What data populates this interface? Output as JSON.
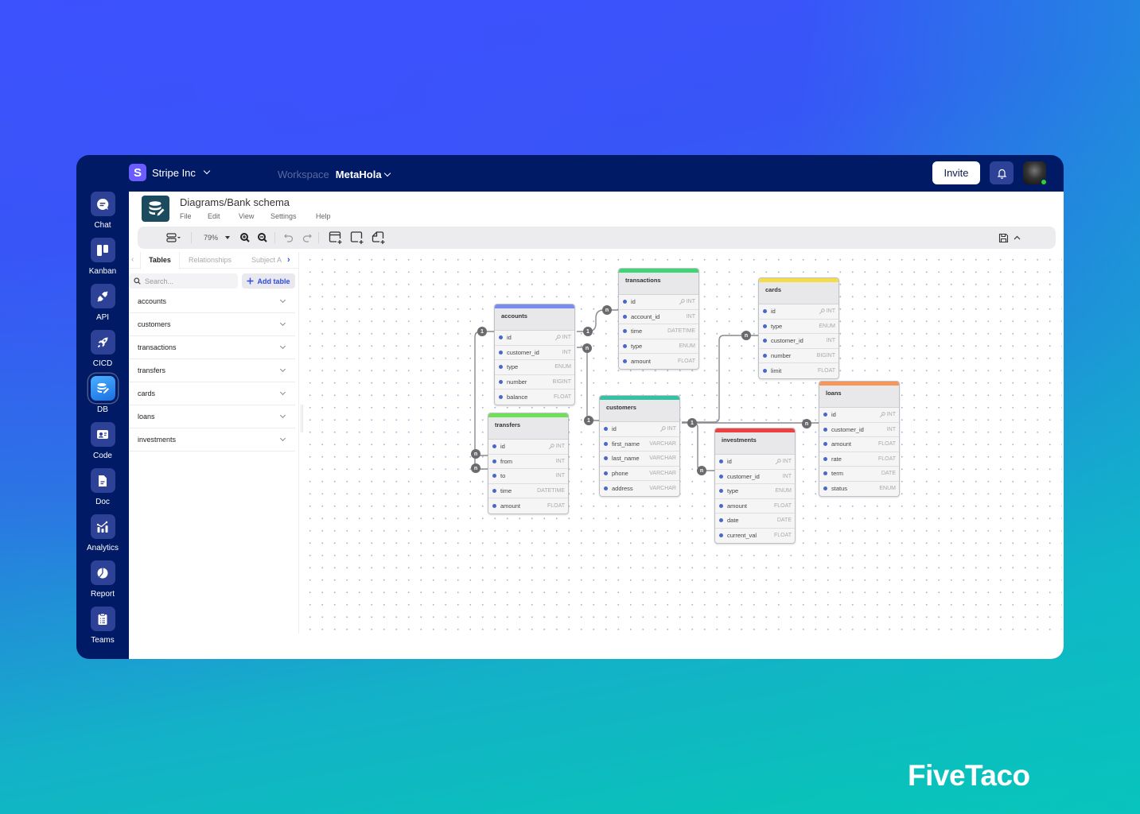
{
  "app": {
    "org_name": "Stripe Inc",
    "org_logo_letter": "S",
    "workspace_label": "Workspace",
    "workspace_name": "MetaHola",
    "invite_label": "Invite"
  },
  "nav": [
    {
      "label": "Chat",
      "icon": "chat-icon"
    },
    {
      "label": "Kanban",
      "icon": "kanban-icon"
    },
    {
      "label": "API",
      "icon": "api-plug-icon"
    },
    {
      "label": "CICD",
      "icon": "rocket-icon"
    },
    {
      "label": "DB",
      "icon": "database-icon",
      "active": true
    },
    {
      "label": "Code",
      "icon": "code-icon"
    },
    {
      "label": "Doc",
      "icon": "document-icon"
    },
    {
      "label": "Analytics",
      "icon": "analytics-icon"
    },
    {
      "label": "Report",
      "icon": "pie-chart-icon"
    },
    {
      "label": "Teams",
      "icon": "clipboard-icon"
    }
  ],
  "document": {
    "title": "Diagrams/Bank schema",
    "menu": [
      "File",
      "Edit",
      "View",
      "Settings",
      "Help"
    ]
  },
  "toolbar": {
    "zoom": "79%"
  },
  "panel": {
    "tabs": [
      "Tables",
      "Relationships",
      "Subject Areas"
    ],
    "active_tab": "Tables",
    "search_placeholder": "Search...",
    "add_table_label": "Add table",
    "tables": [
      "accounts",
      "customers",
      "transactions",
      "transfers",
      "cards",
      "loans",
      "investments"
    ]
  },
  "diagram": {
    "tables": [
      {
        "name": "accounts",
        "color": "#7b8cf0",
        "fields": [
          {
            "name": "id",
            "type": "INT",
            "pk": true
          },
          {
            "name": "customer_id",
            "type": "INT"
          },
          {
            "name": "type",
            "type": "ENUM"
          },
          {
            "name": "number",
            "type": "BIGINT"
          },
          {
            "name": "balance",
            "type": "FLOAT"
          }
        ]
      },
      {
        "name": "transactions",
        "color": "#3ed477",
        "fields": [
          {
            "name": "id",
            "type": "INT",
            "pk": true
          },
          {
            "name": "account_id",
            "type": "INT"
          },
          {
            "name": "time",
            "type": "DATETIME"
          },
          {
            "name": "type",
            "type": "ENUM"
          },
          {
            "name": "amount",
            "type": "FLOAT"
          }
        ]
      },
      {
        "name": "cards",
        "color": "#f5dc4a",
        "fields": [
          {
            "name": "id",
            "type": "INT",
            "pk": true
          },
          {
            "name": "type",
            "type": "ENUM"
          },
          {
            "name": "customer_id",
            "type": "INT"
          },
          {
            "name": "number",
            "type": "BIGINT"
          },
          {
            "name": "limit",
            "type": "FLOAT"
          }
        ]
      },
      {
        "name": "transfers",
        "color": "#6ee05a",
        "fields": [
          {
            "name": "id",
            "type": "INT",
            "pk": true
          },
          {
            "name": "from",
            "type": "INT"
          },
          {
            "name": "to",
            "type": "INT"
          },
          {
            "name": "time",
            "type": "DATETIME"
          },
          {
            "name": "amount",
            "type": "FLOAT"
          }
        ]
      },
      {
        "name": "customers",
        "color": "#33c2a4",
        "fields": [
          {
            "name": "id",
            "type": "INT",
            "pk": true
          },
          {
            "name": "first_name",
            "type": "VARCHAR"
          },
          {
            "name": "last_name",
            "type": "VARCHAR"
          },
          {
            "name": "phone",
            "type": "VARCHAR"
          },
          {
            "name": "address",
            "type": "VARCHAR"
          }
        ]
      },
      {
        "name": "investments",
        "color": "#ee4040",
        "fields": [
          {
            "name": "id",
            "type": "INT",
            "pk": true
          },
          {
            "name": "customer_id",
            "type": "INT"
          },
          {
            "name": "type",
            "type": "ENUM"
          },
          {
            "name": "amount",
            "type": "FLOAT"
          },
          {
            "name": "date",
            "type": "DATE"
          },
          {
            "name": "current_val",
            "type": "FLOAT"
          }
        ]
      },
      {
        "name": "loans",
        "color": "#f5965a",
        "fields": [
          {
            "name": "id",
            "type": "INT",
            "pk": true
          },
          {
            "name": "customer_id",
            "type": "INT"
          },
          {
            "name": "amount",
            "type": "FLOAT"
          },
          {
            "name": "rate",
            "type": "FLOAT"
          },
          {
            "name": "term",
            "type": "DATE"
          },
          {
            "name": "status",
            "type": "ENUM"
          }
        ]
      }
    ],
    "relationships": [
      {
        "from": "accounts.id",
        "to": "transactions.account_id",
        "cardinality": [
          "1",
          "n"
        ]
      },
      {
        "from": "accounts.id",
        "to": "transfers.from",
        "cardinality": [
          "1",
          "n"
        ]
      },
      {
        "from": "accounts.id",
        "to": "transfers.to",
        "cardinality": [
          "1",
          "n"
        ]
      },
      {
        "from": "customers.id",
        "to": "accounts.customer_id",
        "cardinality": [
          "1",
          "n"
        ]
      },
      {
        "from": "customers.id",
        "to": "cards.customer_id",
        "cardinality": [
          "1",
          "n"
        ]
      },
      {
        "from": "customers.id",
        "to": "loans.customer_id",
        "cardinality": [
          "1",
          "n"
        ]
      },
      {
        "from": "customers.id",
        "to": "investments.customer_id",
        "cardinality": [
          "1",
          "n"
        ]
      }
    ]
  },
  "brand": "FiveTaco"
}
